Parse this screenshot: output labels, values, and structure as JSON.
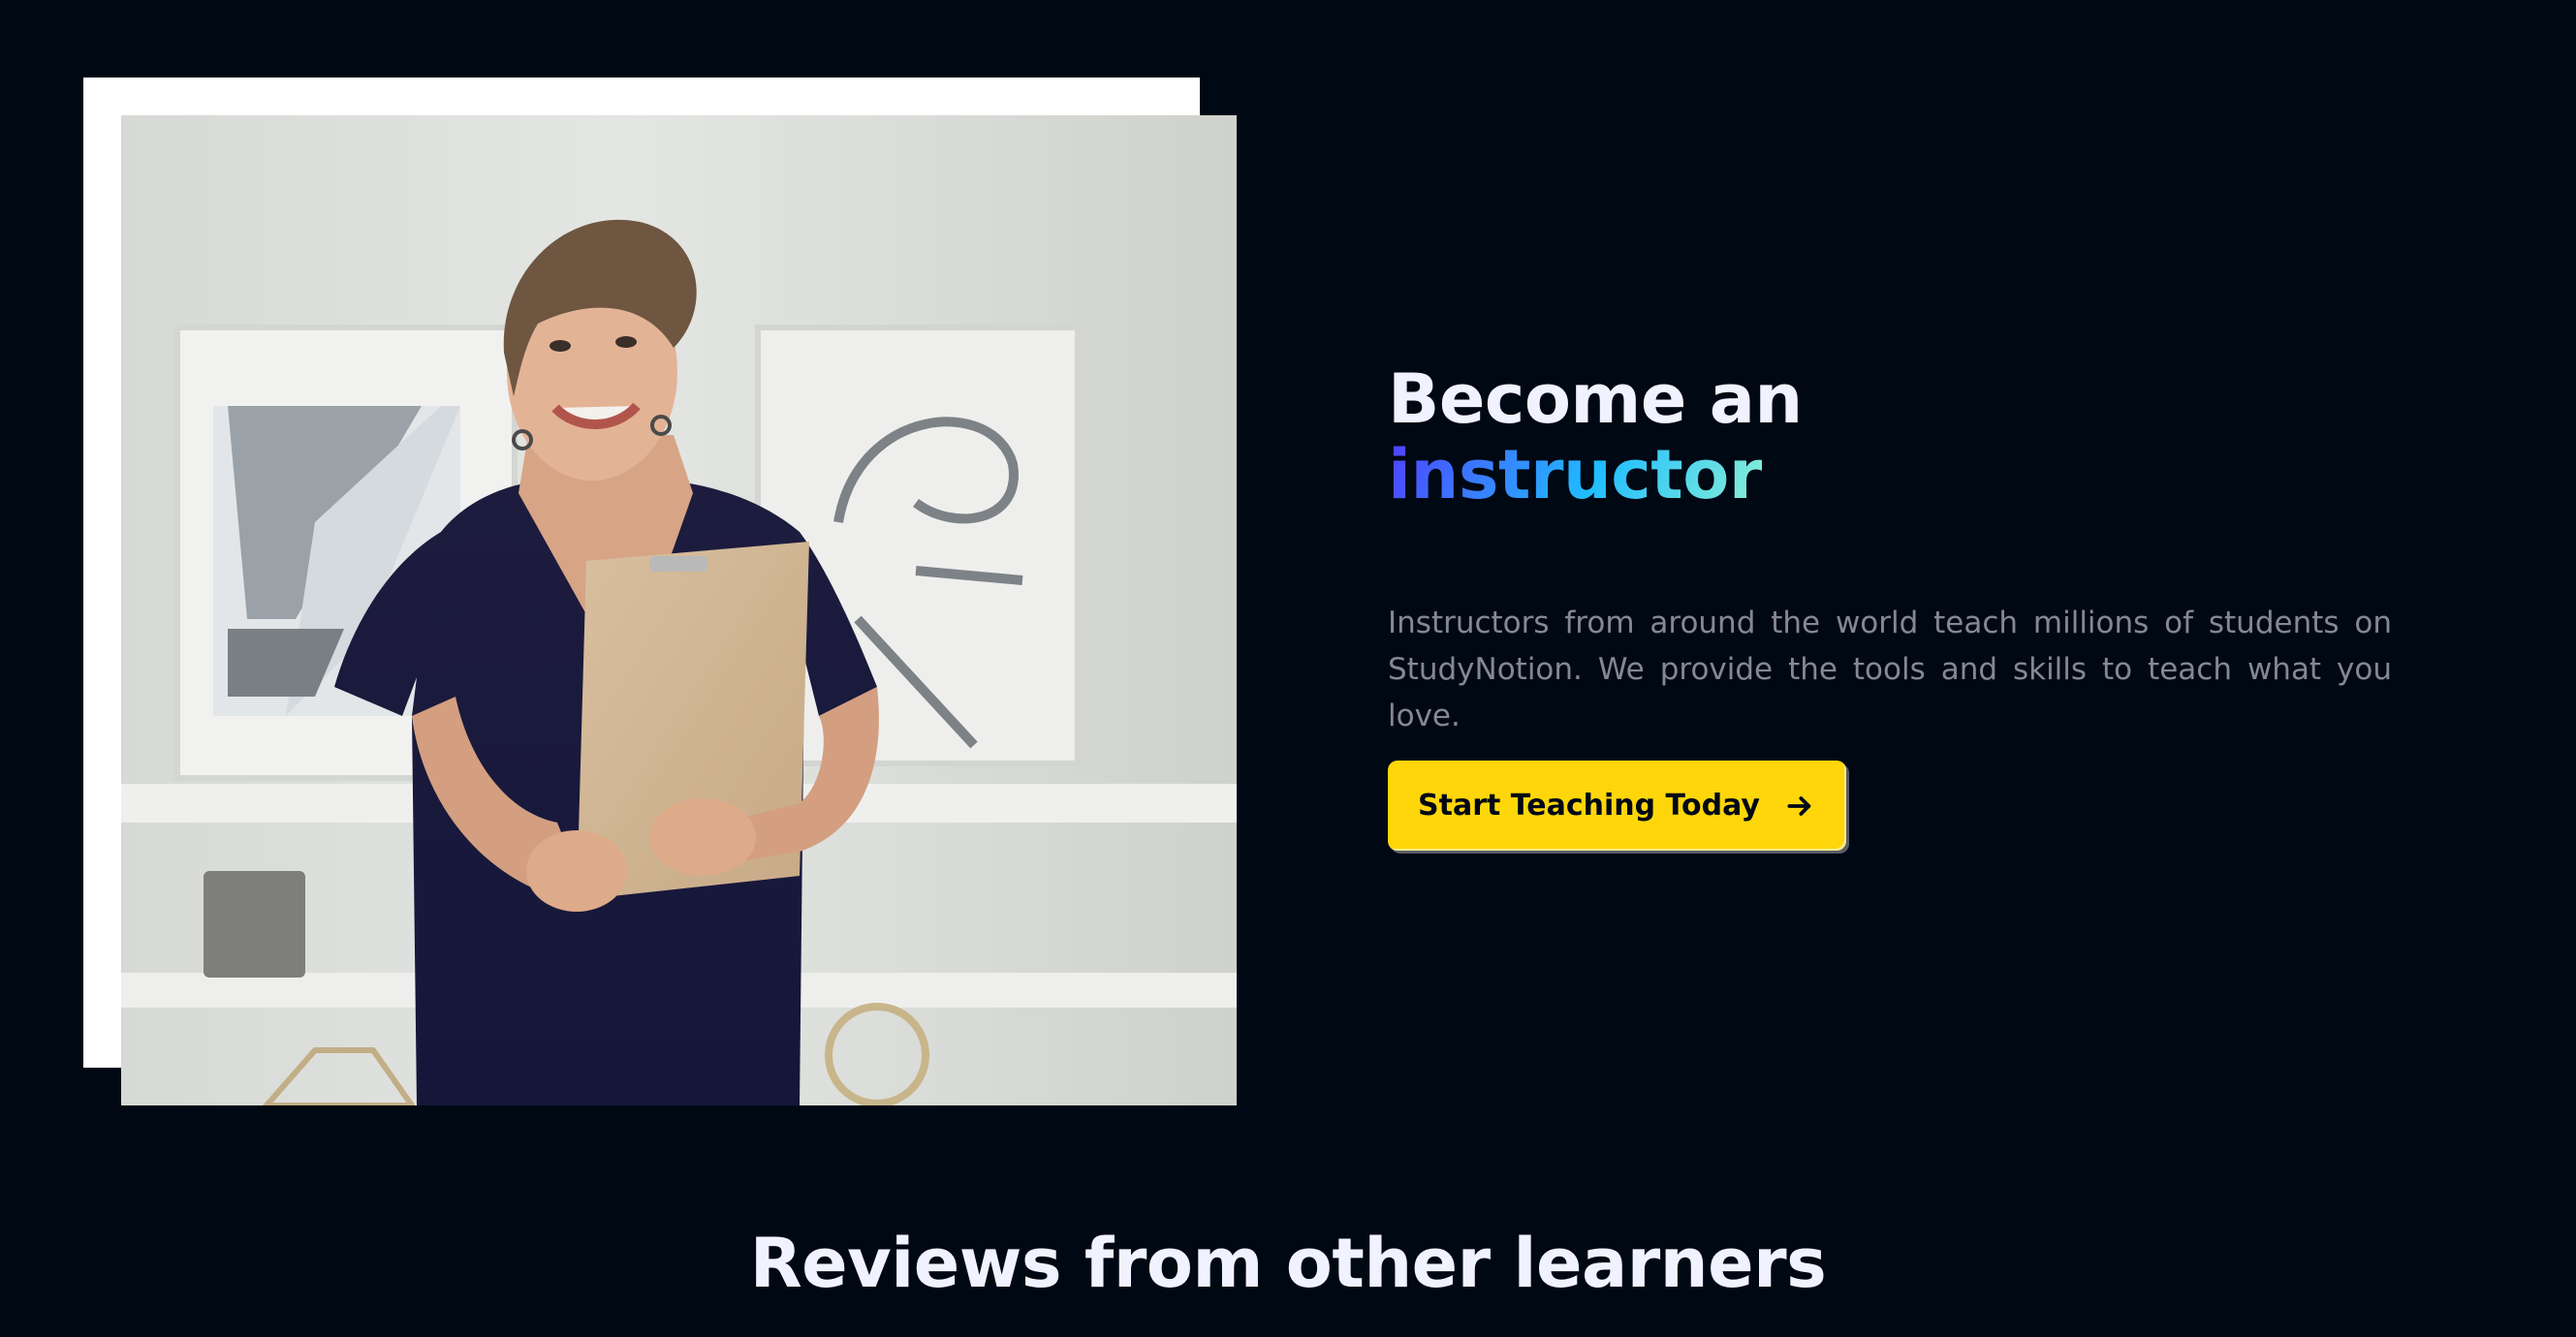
{
  "instructor_section": {
    "heading_line1": "Become an",
    "heading_highlight": "instructor",
    "description": "Instructors from around the world teach millions of students on StudyNotion. We provide the tools and skills to teach what you love.",
    "cta_label": "Start Teaching Today",
    "cta_icon": "arrow-right-icon",
    "image_icon": "instructor-photo"
  },
  "reviews_section": {
    "title": "Reviews from other learners"
  },
  "colors": {
    "background": "#000814",
    "heading": "#F1F2FF",
    "description": "#838894",
    "cta_background": "#FFD60A",
    "cta_text": "#000814",
    "highlight_gradient": [
      "#5433FF",
      "#20BDFF",
      "#A5FECB"
    ]
  }
}
